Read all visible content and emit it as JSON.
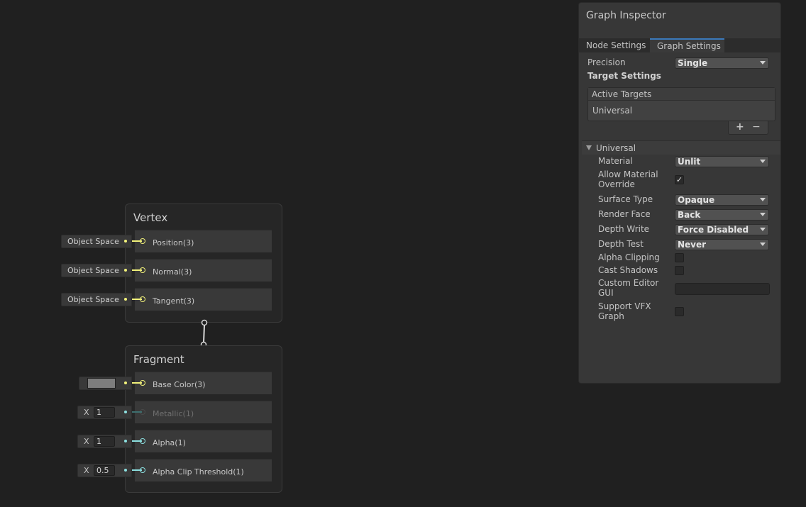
{
  "vertex": {
    "title": "Vertex",
    "ports": [
      {
        "label": "Position(3)",
        "input": "Object Space"
      },
      {
        "label": "Normal(3)",
        "input": "Object Space"
      },
      {
        "label": "Tangent(3)",
        "input": "Object Space"
      }
    ]
  },
  "fragment": {
    "title": "Fragment",
    "ports": [
      {
        "label": "Base Color(3)"
      },
      {
        "label": "Metallic(1)",
        "axis": "X",
        "value": "1"
      },
      {
        "label": "Alpha(1)",
        "axis": "X",
        "value": "1"
      },
      {
        "label": "Alpha Clip Threshold(1)",
        "axis": "X",
        "value": "0.5"
      }
    ]
  },
  "inspector": {
    "title": "Graph Inspector",
    "tabs": [
      "Node Settings",
      "Graph Settings"
    ],
    "precision_label": "Precision",
    "precision_value": "Single",
    "target_settings_label": "Target Settings",
    "active_targets_header": "Active Targets",
    "active_targets": [
      "Universal"
    ],
    "add_symbol": "+",
    "remove_symbol": "−",
    "universal_foldout": "Universal",
    "material_label": "Material",
    "material_value": "Unlit",
    "allow_override_label_1": "Allow Material",
    "allow_override_label_2": "Override",
    "allow_override_check": "✓",
    "surface_type_label": "Surface Type",
    "surface_type_value": "Opaque",
    "render_face_label": "Render Face",
    "render_face_value": "Back",
    "depth_write_label": "Depth Write",
    "depth_write_value": "Force Disabled",
    "depth_test_label": "Depth Test",
    "depth_test_value": "Never",
    "alpha_clipping_label": "Alpha Clipping",
    "cast_shadows_label": "Cast Shadows",
    "custom_editor_label_1": "Custom Editor",
    "custom_editor_label_2": "GUI",
    "custom_editor_value": "",
    "support_vfx_label_1": "Support VFX",
    "support_vfx_label_2": "Graph"
  },
  "colors": {
    "vector3_port": "#f2f27a",
    "float_port": "#8ce0e0",
    "tab_accent": "#3a79bb",
    "base_color_swatch": "#7d7d7d"
  }
}
